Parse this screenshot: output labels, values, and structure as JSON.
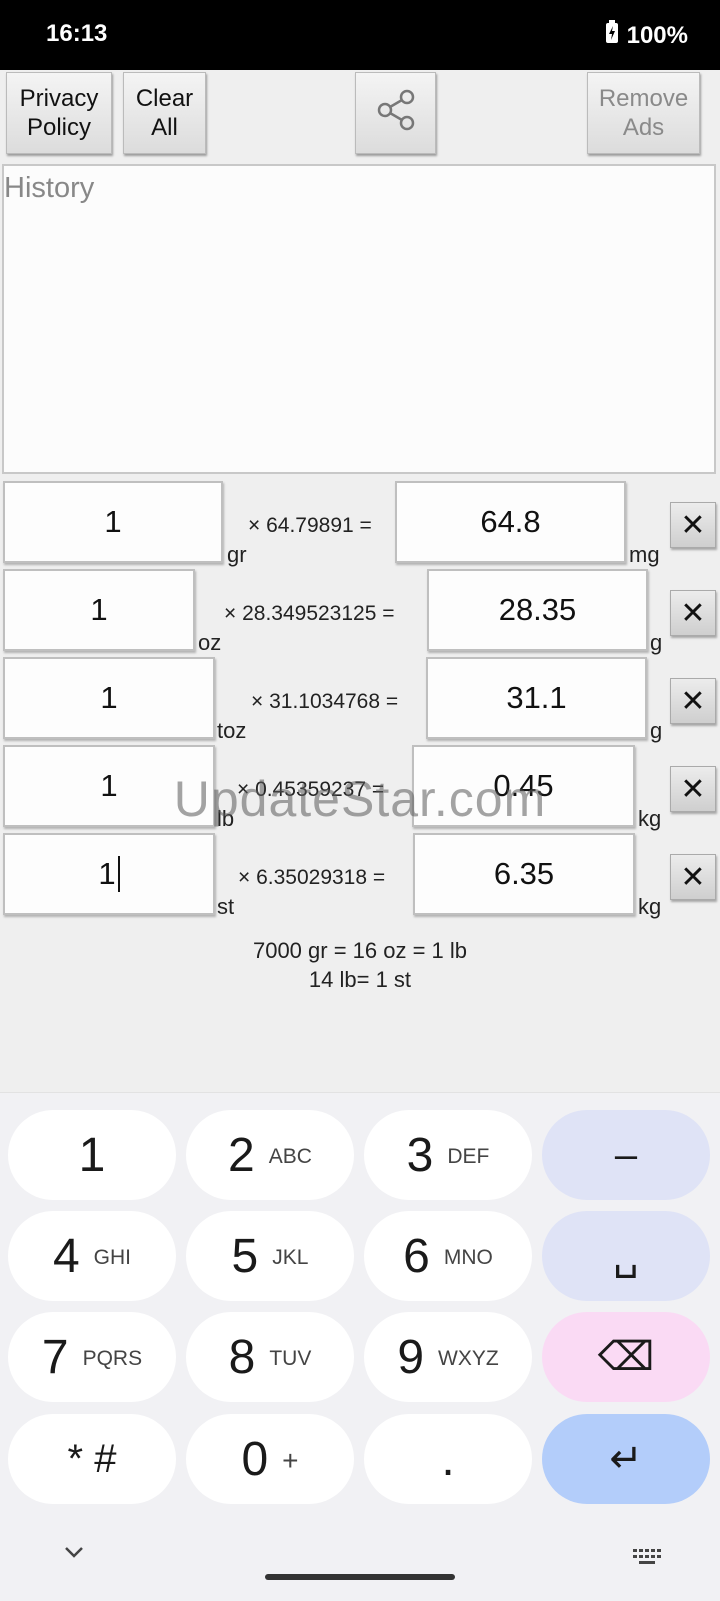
{
  "status": {
    "time": "16:13",
    "battery": "100%"
  },
  "toolbar": {
    "privacy_line1": "Privacy",
    "privacy_line2": "Policy",
    "clear_line1": "Clear",
    "clear_line2": "All",
    "remove_line1": "Remove",
    "remove_line2": "Ads",
    "share_icon": "share-icon"
  },
  "history": {
    "placeholder": "History"
  },
  "rows": [
    {
      "input": "1",
      "from_unit": "gr",
      "factor": "× 64.79891 =",
      "result": "64.8",
      "to_unit": "mg"
    },
    {
      "input": "1",
      "from_unit": "oz",
      "factor": "× 28.349523125 =",
      "result": "28.35",
      "to_unit": "g"
    },
    {
      "input": "1",
      "from_unit": "toz",
      "factor": "× 31.1034768 =",
      "result": "31.1",
      "to_unit": "g"
    },
    {
      "input": "1",
      "from_unit": "lb",
      "factor": "× 0.45359237 =",
      "result": "0.45",
      "to_unit": "kg"
    },
    {
      "input": "1",
      "from_unit": "st",
      "factor": "× 6.35029318 =",
      "result": "6.35",
      "to_unit": "kg"
    }
  ],
  "info": {
    "line1": "7000 gr = 16 oz = 1 lb",
    "line2": "14 lb= 1 st"
  },
  "watermark": "UpdateStar.com",
  "keyboard": {
    "keys": [
      {
        "main": "1",
        "sub": ""
      },
      {
        "main": "2",
        "sub": "ABC"
      },
      {
        "main": "3",
        "sub": "DEF"
      },
      {
        "main": "–",
        "sub": ""
      },
      {
        "main": "4",
        "sub": "GHI"
      },
      {
        "main": "5",
        "sub": "JKL"
      },
      {
        "main": "6",
        "sub": "MNO"
      },
      {
        "main": "␣",
        "sub": ""
      },
      {
        "main": "7",
        "sub": "PQRS"
      },
      {
        "main": "8",
        "sub": "TUV"
      },
      {
        "main": "9",
        "sub": "WXYZ"
      },
      {
        "main": "⌫",
        "sub": ""
      },
      {
        "main": "* #",
        "sub": ""
      },
      {
        "main": "0",
        "sub": "+"
      },
      {
        "main": ".",
        "sub": ""
      },
      {
        "main": "↵",
        "sub": ""
      }
    ],
    "hide_icon": "chevron-down-icon",
    "switch_icon": "keyboard-icon"
  }
}
